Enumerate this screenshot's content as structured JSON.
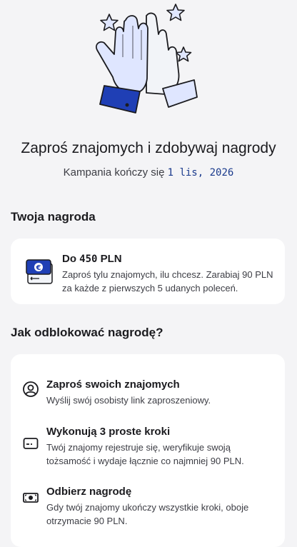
{
  "header": {
    "title": "Zaproś znajomych i zdobywaj nagrody",
    "subtitle_prefix": "Kampania kończy się",
    "end_date": "1 lis, 2026"
  },
  "reward_section": {
    "title": "Twoja nagroda",
    "card": {
      "icon": "cash-euro-icon",
      "heading_prefix": "Do",
      "heading_amount": "450",
      "heading_currency": "PLN",
      "description": "Zaproś tylu znajomych, ilu chcesz. Zarabiaj 90 PLN za każde z pierwszych 5 udanych poleceń."
    }
  },
  "how_section": {
    "title": "Jak odblokować nagrodę?",
    "steps": [
      {
        "icon": "person-circle-icon",
        "title": "Zaproś swoich znajomych",
        "description": "Wyślij swój osobisty link zaproszeniowy."
      },
      {
        "icon": "card-icon",
        "title": "Wykonują 3 proste kroki",
        "description": "Twój znajomy rejestruje się, weryfikuje swoją tożsamość i wydaje łącznie co najmniej 90 PLN."
      },
      {
        "icon": "money-icon",
        "title": "Odbierz nagrodę",
        "description": "Gdy twój znajomy ukończy wszystkie kroki, oboje otrzymacie 90 PLN."
      }
    ]
  },
  "colors": {
    "background": "#f4f4f6",
    "card": "#ffffff",
    "accent_blue": "#1f3fb5",
    "date_blue": "#1a3a8c"
  }
}
